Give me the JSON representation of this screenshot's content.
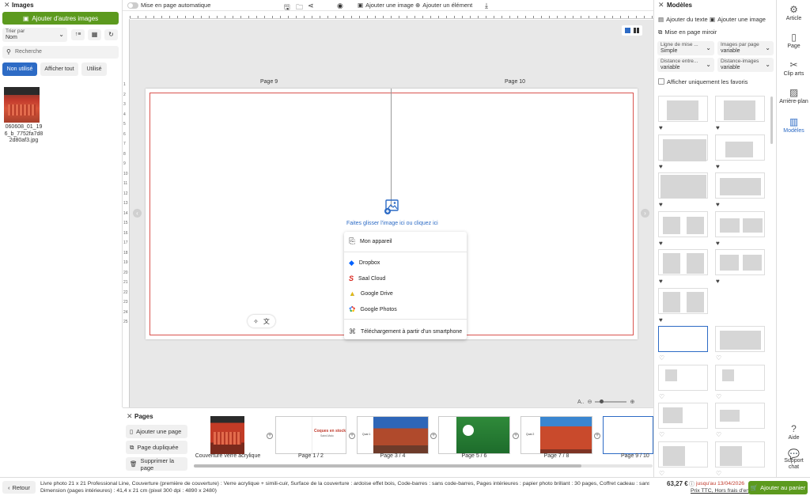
{
  "left_panel": {
    "title": "Images",
    "add_images_button": "Ajouter d'autres images",
    "sort_label": "Trier par",
    "sort_value": "Nom",
    "search_placeholder": "Recherche",
    "filters": [
      "Non utilisé",
      "Afficher tout",
      "Utilisé"
    ],
    "image_filename": "060608_01_19 6_b_7752fa7d8 2d80af3.jpg"
  },
  "toolbar": {
    "auto_layout": "Mise en page automatique",
    "add_image": "Ajouter une image",
    "add_element": "Ajouter un élément"
  },
  "canvas": {
    "page_left_label": "Page 9",
    "page_right_label": "Page 10",
    "drop_hint": "Faites glisser l'image ici ou cliquez ici",
    "ruler_numbers": [
      "1",
      "2",
      "3",
      "4",
      "5",
      "6",
      "7",
      "8",
      "9",
      "10",
      "11",
      "12",
      "13",
      "14",
      "15",
      "16",
      "17",
      "18",
      "19",
      "20",
      "21",
      "22",
      "23",
      "24",
      "25"
    ],
    "zoom_label": "A.."
  },
  "upload_menu": {
    "items": [
      "Mon appareil",
      "Dropbox",
      "Saal Cloud",
      "Google Drive",
      "Google Photos",
      "Téléchargement à partir d'un smartphone"
    ]
  },
  "models_panel": {
    "title": "Modèles",
    "add_text": "Ajouter du texte",
    "add_image": "Ajouter une image",
    "mirror": "Mise en page miroir",
    "line_label": "Ligne de mise ...",
    "line_value": "Simple",
    "images_per_page_label": "Images par page",
    "images_per_page_value": "variable",
    "distance_between_label": "Distance entre...",
    "distance_between_value": "variable",
    "distance_images_label": "Distance-images",
    "distance_images_value": "variable",
    "favorites_only": "Afficher uniquement les favoris"
  },
  "right_rail": {
    "items": [
      "Article",
      "Page",
      "Clip arts",
      "Arrière-plan",
      "Modèles"
    ],
    "help": "Aide",
    "support": "Support chat"
  },
  "pages_panel": {
    "title": "Pages",
    "add_page": "Ajouter une page",
    "duplicate_page": "Page dupliquée",
    "delete_page": "Supprimer la page",
    "page_labels": [
      "Couverture verre acrylique",
      "Page 1 / 2",
      "Page 3 / 4",
      "Page 5 / 6",
      "Page 7 / 8",
      "Page 9 / 10"
    ],
    "cover_text_title": "Coques en stock",
    "cover_text_sub": "Saint-Malo",
    "mini_label": "Quai 1",
    "mini_label2": "Quai 2"
  },
  "footer": {
    "back": "Retour",
    "description_line1": "Livre photo 21 x 21 Professional Line, Couverture (première de couverture) : Verre acrylique + simili-cuir, Surface de la couverture : ardoise effet bois, Code-barres : sans code-barres, Pages intérieures : papier photo brillant : 30 pages, Coffret cadeau : sans",
    "description_line2": "Dimension (pages intérieures) : 41,4 x 21 cm (pixel 300 dpi : 4890 x 2480)",
    "price": "63,27 €",
    "until": "jusqu'au 13/04/2026",
    "price_note": "Prix TTC, Hors frais d'envoi",
    "cart_button": "Ajouter au panier"
  },
  "colors": {
    "green": "#5c9a1e",
    "blue": "#2d6bc5",
    "red_guide": "#d9534f"
  }
}
